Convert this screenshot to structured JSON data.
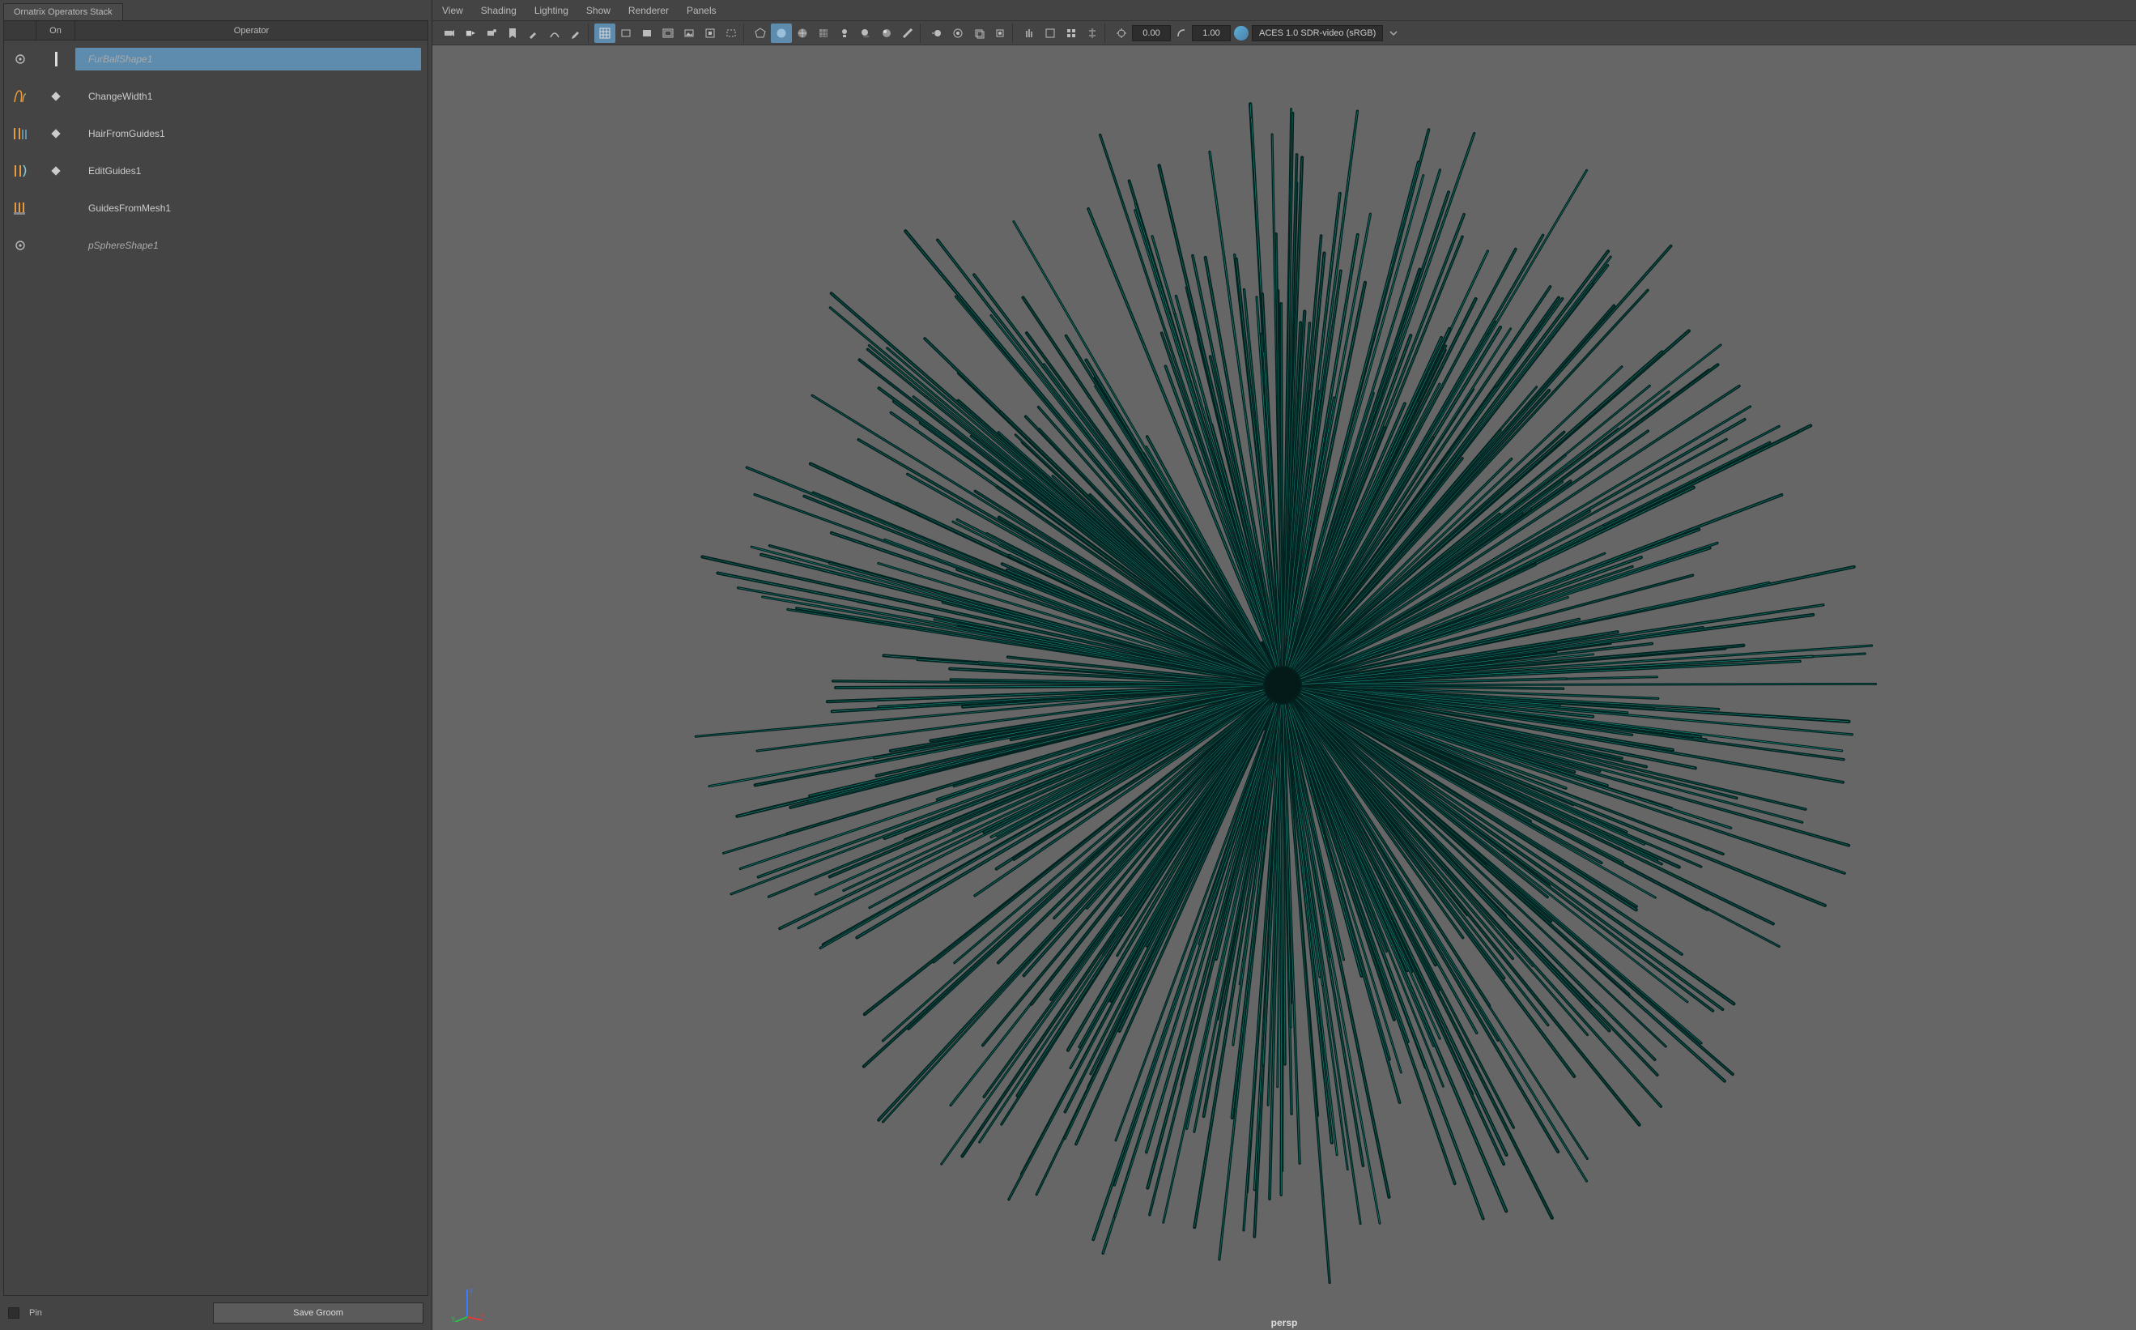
{
  "panel": {
    "title": "Ornatrix Operators Stack",
    "header": {
      "on": "On",
      "operator": "Operator"
    },
    "rows": [
      {
        "name": "FurBallShape1",
        "kind": "shape-top",
        "on": true,
        "selected": true,
        "icon": "gear"
      },
      {
        "name": "ChangeWidth1",
        "kind": "op",
        "on": true,
        "selected": false,
        "icon": "changewidth"
      },
      {
        "name": "HairFromGuides1",
        "kind": "op",
        "on": true,
        "selected": false,
        "icon": "hairfromguides"
      },
      {
        "name": "EditGuides1",
        "kind": "op",
        "on": true,
        "selected": false,
        "icon": "editguides"
      },
      {
        "name": "GuidesFromMesh1",
        "kind": "op",
        "on": false,
        "selected": false,
        "icon": "guidesfrommesh"
      },
      {
        "name": "pSphereShape1",
        "kind": "shape-bot",
        "on": false,
        "selected": false,
        "icon": "gear"
      }
    ],
    "footer": {
      "pin": "Pin",
      "save": "Save Groom"
    }
  },
  "viewport": {
    "menus": [
      "View",
      "Shading",
      "Lighting",
      "Show",
      "Renderer",
      "Panels"
    ],
    "toolbar": {
      "field1": "0.00",
      "field2": "1.00",
      "colorspace": "ACES 1.0 SDR-video (sRGB)"
    },
    "camera_label": "persp",
    "fur_color": "#1fd7c4",
    "strand_count": 520
  }
}
